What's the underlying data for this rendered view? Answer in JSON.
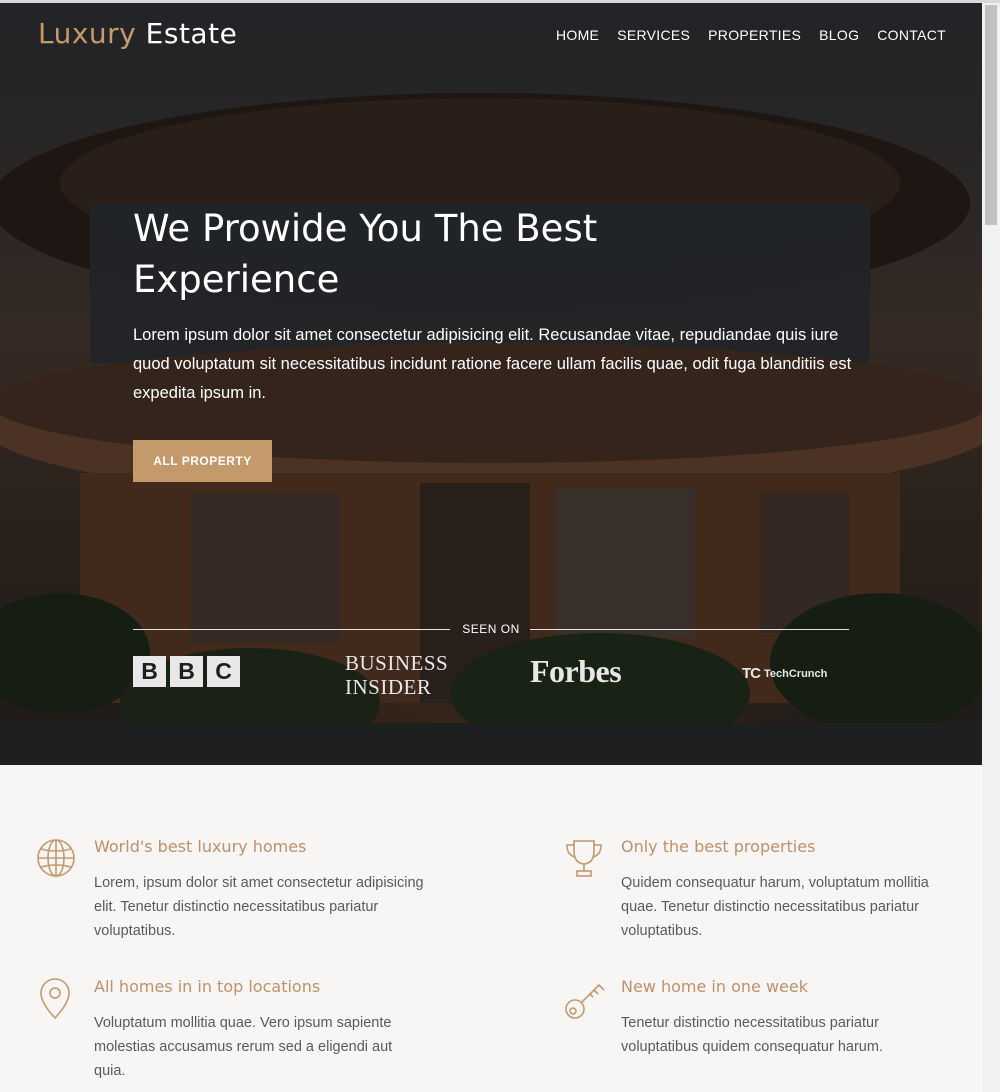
{
  "brand": {
    "part1": "Luxury",
    "part2": "Estate"
  },
  "nav": [
    "HOME",
    "SERVICES",
    "PROPERTIES",
    "BLOG",
    "CONTACT"
  ],
  "hero": {
    "title": "We Prowide You The Best Experience",
    "text": "Lorem ipsum dolor sit amet consectetur adipisicing elit. Recusandae vitae, repudiandae quis iure quod voluptatum sit necessitatibus incidunt ratione facere ullam facilis quae, odit fuga blanditiis est expedita ipsum in.",
    "button": "ALL PROPERTY"
  },
  "seen_on": {
    "label": "SEEN ON",
    "brands": {
      "bbc": [
        "B",
        "B",
        "C"
      ],
      "business_insider": [
        "BUSINESS",
        "INSIDER"
      ],
      "forbes": "Forbes",
      "techcrunch_mark": "TC",
      "techcrunch_name": "TechCrunch"
    }
  },
  "features": [
    {
      "icon": "globe-icon",
      "title": "World's best luxury homes",
      "text": "Lorem, ipsum dolor sit amet consectetur adipisicing elit. Tenetur distinctio necessitatibus pariatur voluptatibus."
    },
    {
      "icon": "trophy-icon",
      "title": "Only the best properties",
      "text": "Quidem consequatur harum, voluptatum mollitia quae. Tenetur distinctio necessitatibus pariatur voluptatibus."
    },
    {
      "icon": "location-pin-icon",
      "title": "All homes in in top locations",
      "text": "Voluptatum mollitia quae. Vero ipsum sapiente molestias accusamus rerum sed a eligendi aut quia."
    },
    {
      "icon": "key-icon",
      "title": "New home in one week",
      "text": "Tenetur distinctio necessitatibus pariatur voluptatibus quidem consequatur harum."
    }
  ],
  "colors": {
    "accent": "#c49a6c",
    "feature_title": "#c0906a",
    "body_text": "#5a5a5a",
    "section_bg": "#f7f6f4"
  }
}
